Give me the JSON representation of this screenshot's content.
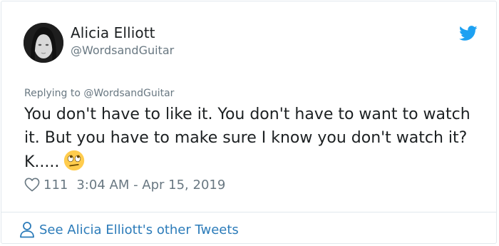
{
  "author": {
    "name": "Alicia Elliott",
    "handle": "@WordsandGuitar"
  },
  "reply": {
    "label": "Replying to @WordsandGuitar"
  },
  "tweet": {
    "text": "You don't have to like it. You don't have to want to watch it. But you have to make sure I know you don't watch it? K.....",
    "emoji": "eye-roll-emoji"
  },
  "meta": {
    "likes": "111",
    "timestamp": "3:04 AM - Apr 15, 2019"
  },
  "footer": {
    "link_label": "See Alicia Elliott's other Tweets"
  },
  "colors": {
    "accent": "#1da1f2",
    "link": "#2b7bb9",
    "muted": "#697882",
    "text": "#1c2022"
  }
}
